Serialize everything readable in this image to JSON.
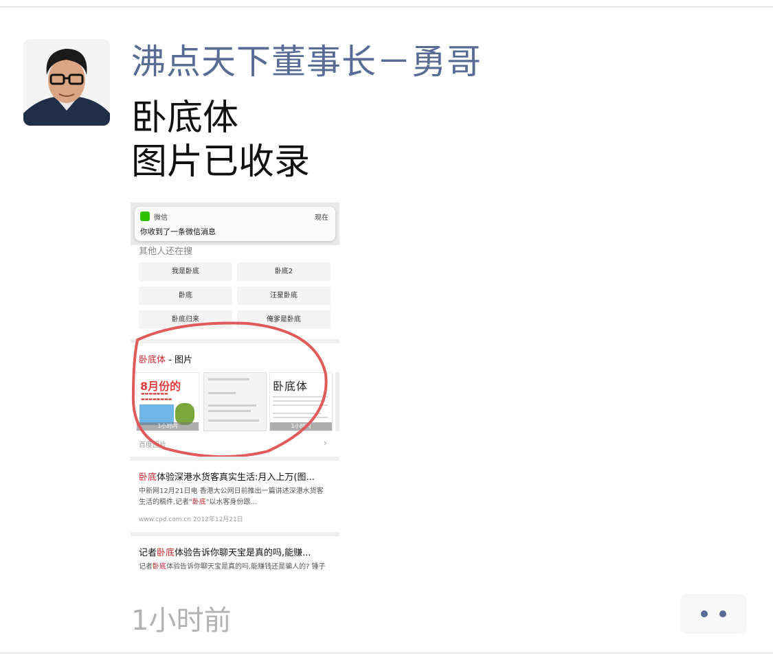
{
  "post": {
    "author": "沸点天下董事长－勇哥",
    "text_lines": [
      "卧底体",
      "图片已收录"
    ],
    "time_ago": "1小时前"
  },
  "icons": {
    "avatar": "avatar-photo",
    "more": "more-dots-icon",
    "wechat": "wechat-icon",
    "chevron": "chevron-right-icon"
  },
  "colors": {
    "author": "#576b95",
    "highlight": "#c2232b",
    "annotation": "#e05a5a",
    "time": "#b2b2b2"
  },
  "screenshot": {
    "notification": {
      "app": "微信",
      "time": "现在",
      "message": "你收到了一条微信消息"
    },
    "others_search_label": "其他人还在搜",
    "chips": [
      "我是卧底",
      "卧底2",
      "卧底",
      "汪星卧底",
      "卧底归来",
      "俺爹是卧底"
    ],
    "images_section": {
      "title_highlight": "卧底体",
      "title_rest": " - 图片",
      "thumb_captions": [
        "1小时内",
        "",
        "1小时内"
      ],
      "thumb1_big": "8月份的",
      "thumb3_title": "卧底体",
      "footer": "百度图片",
      "chevron": "›"
    },
    "results": [
      {
        "title_highlight": "卧底",
        "title_rest": "体验深港水货客真实生活:月入上万(图...",
        "desc_line1": "中新网12月21日电 香港大公网日前推出一篇讲述深港水货客",
        "desc_line2_pre": "生活的稿件,记者\"",
        "desc_line2_hl": "卧底",
        "desc_line2_post": "\"以水客身份跟...",
        "meta": "www.cpd.com.cn  2012年12月21日"
      },
      {
        "title_pre": "记者",
        "title_highlight": "卧底",
        "title_rest": "体验告诉你聊天宝是真的吗,能赚...",
        "desc_pre": "记者",
        "desc_hl": "卧底",
        "desc_post": "体验告诉你聊天宝是真的吗,能赚钱还是骗人的? 锤子"
      }
    ]
  }
}
